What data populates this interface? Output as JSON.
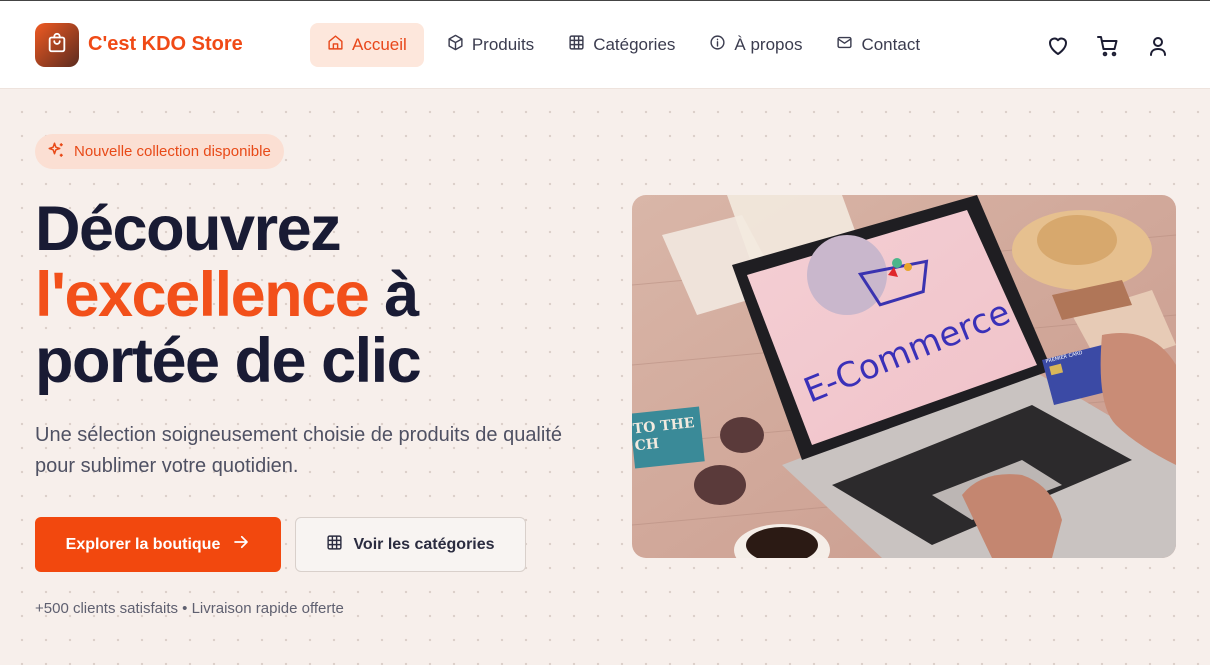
{
  "brand": {
    "name": "C'est KDO Store",
    "logo_icon": "shopping-bag-icon"
  },
  "nav": {
    "items": [
      {
        "label": "Accueil",
        "icon": "home-icon",
        "active": true
      },
      {
        "label": "Produits",
        "icon": "box-icon",
        "active": false
      },
      {
        "label": "Catégories",
        "icon": "grid-icon",
        "active": false
      },
      {
        "label": "À propos",
        "icon": "info-icon",
        "active": false
      },
      {
        "label": "Contact",
        "icon": "mail-icon",
        "active": false
      }
    ],
    "actions": [
      "heart-icon",
      "cart-icon",
      "user-icon"
    ]
  },
  "hero": {
    "badge": "Nouvelle collection disponible",
    "title_line1": "Découvrez",
    "title_accent": "l'excellence",
    "title_after_accent": "à",
    "title_line3": "portée de clic",
    "subtitle": "Une sélection soigneusement choisie de produits de qualité pour sublimer votre quotidien.",
    "primary_button": "Explorer la boutique",
    "secondary_button": "Voir les catégories",
    "stats": "+500 clients satisfaits • Livraison rapide offerte",
    "image_text": "E-Commerce",
    "sign_text_1": "TO THE",
    "sign_text_2": "CH",
    "card_text": "PREMIER CARD"
  },
  "colors": {
    "accent": "#f2480e",
    "brand_text": "#f04a16",
    "active_bg": "#fde7dc",
    "heading": "#191b34"
  }
}
